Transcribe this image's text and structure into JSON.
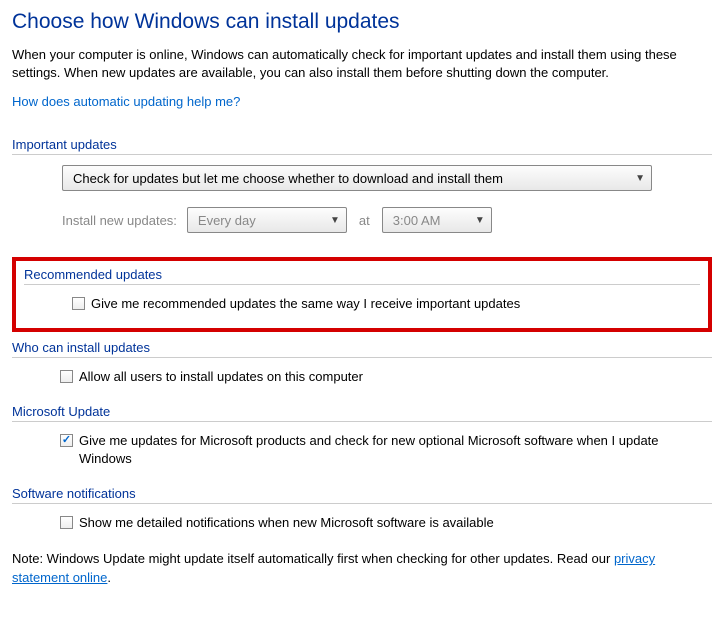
{
  "page_title": "Choose how Windows can install updates",
  "intro_text": "When your computer is online, Windows can automatically check for important updates and install them using these settings. When new updates are available, you can also install them before shutting down the computer.",
  "help_link": "How does automatic updating help me?",
  "important_updates": {
    "header": "Important updates",
    "dropdown_value": "Check for updates but let me choose whether to download and install them",
    "schedule_label": "Install new updates:",
    "frequency_value": "Every day",
    "at_label": "at",
    "time_value": "3:00 AM"
  },
  "recommended_updates": {
    "header": "Recommended updates",
    "checkbox_label": "Give me recommended updates the same way I receive important updates",
    "checked": false
  },
  "who_can_install": {
    "header": "Who can install updates",
    "checkbox_label": "Allow all users to install updates on this computer",
    "checked": false
  },
  "microsoft_update": {
    "header": "Microsoft Update",
    "checkbox_label": "Give me updates for Microsoft products and check for new optional Microsoft software when I update Windows",
    "checked": true
  },
  "software_notifications": {
    "header": "Software notifications",
    "checkbox_label": "Show me detailed notifications when new Microsoft software is available",
    "checked": false
  },
  "footer_note_prefix": "Note: Windows Update might update itself automatically first when checking for other updates.  Read our ",
  "privacy_link": "privacy statement online",
  "footer_note_suffix": "."
}
